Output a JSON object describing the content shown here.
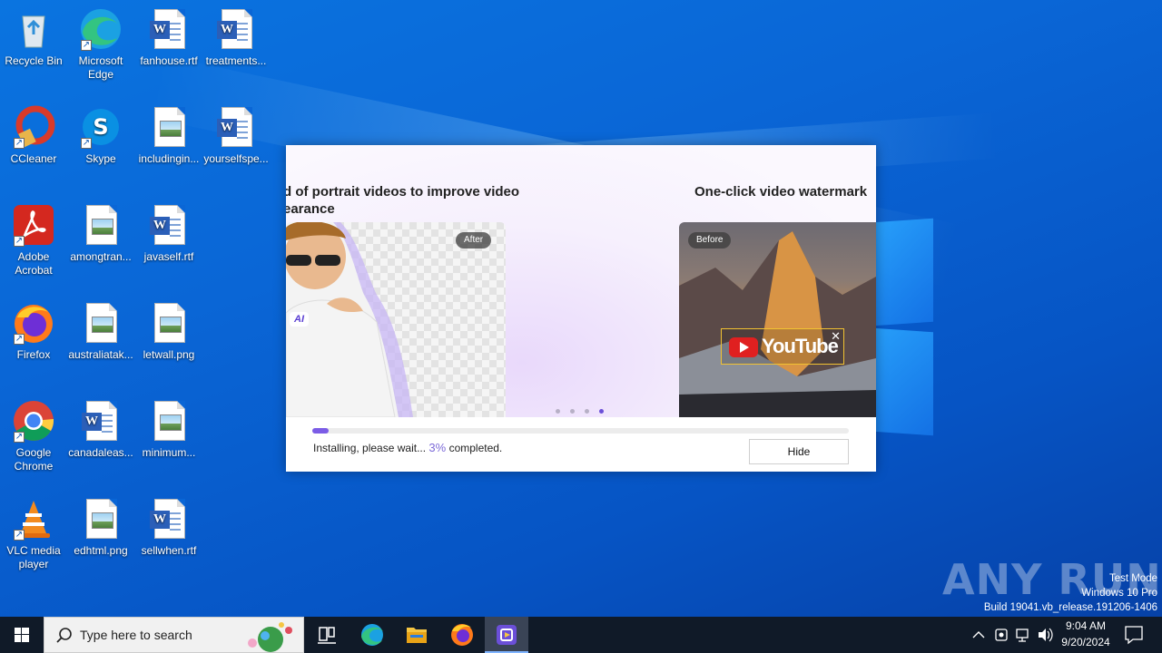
{
  "desktop": {
    "icons": [
      {
        "label": "Recycle Bin",
        "icon": "recycle-bin-icon"
      },
      {
        "label": "Microsoft Edge",
        "icon": "edge-icon"
      },
      {
        "label": "fanhouse.rtf",
        "icon": "word-document-icon"
      },
      {
        "label": "treatments...",
        "icon": "word-document-icon"
      },
      {
        "label": "CCleaner",
        "icon": "ccleaner-icon"
      },
      {
        "label": "Skype",
        "icon": "skype-icon"
      },
      {
        "label": "includingin...",
        "icon": "image-file-icon"
      },
      {
        "label": "yourselfspe...",
        "icon": "word-document-icon"
      },
      {
        "label": "Adobe Acrobat",
        "icon": "acrobat-icon"
      },
      {
        "label": "amongtran...",
        "icon": "image-file-icon"
      },
      {
        "label": "javaself.rtf",
        "icon": "word-document-icon"
      },
      {
        "label": "Firefox",
        "icon": "firefox-icon"
      },
      {
        "label": "australiatak...",
        "icon": "image-file-icon"
      },
      {
        "label": "letwall.png",
        "icon": "image-file-icon"
      },
      {
        "label": "Google Chrome",
        "icon": "chrome-icon"
      },
      {
        "label": "canadaleas...",
        "icon": "word-document-icon"
      },
      {
        "label": "minimum...",
        "icon": "image-file-icon"
      },
      {
        "label": "VLC media player",
        "icon": "vlc-icon"
      },
      {
        "label": "edhtml.png",
        "icon": "image-file-icon"
      },
      {
        "label": "sellwhen.rtf",
        "icon": "word-document-icon"
      }
    ]
  },
  "installer": {
    "slide_left_title_line1": "d of portrait videos to improve video",
    "slide_left_title_line2": "earance",
    "slide_right_title": "One-click video watermark",
    "after_label": "After",
    "before_label": "Before",
    "ai_badge": "AI",
    "youtube_text": "YouTube",
    "slide_count": 4,
    "active_slide": 4,
    "progress_percent": 3,
    "status_prefix": "Installing, please wait...",
    "status_percent": "3%",
    "status_suffix": "completed.",
    "hide_button": "Hide"
  },
  "watermark": {
    "brand": "ANY RUN",
    "line1": "Test Mode",
    "line2": "Windows 10 Pro",
    "line3": "Build 19041.vb_release.191206-1406"
  },
  "taskbar": {
    "search_placeholder": "Type here to search",
    "pinned": [
      "task-view-icon",
      "edge-icon",
      "file-explorer-icon",
      "firefox-icon",
      "installer-app-icon"
    ],
    "clock_time": "9:04 AM",
    "clock_date": "9/20/2024"
  },
  "colors": {
    "desktop_blue": "#0a66d6",
    "accent_purple": "#7b5ce6",
    "taskbar": "#101a28"
  }
}
